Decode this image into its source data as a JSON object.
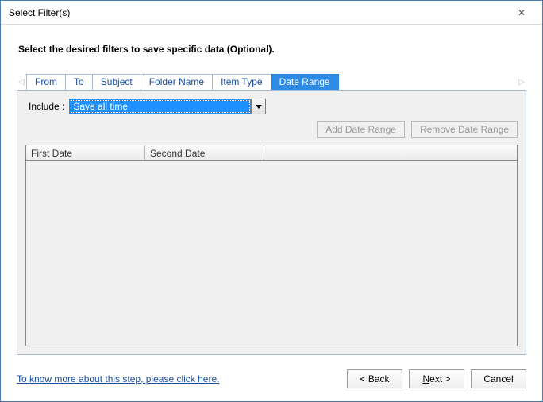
{
  "title": "Select Filter(s)",
  "instruction": "Select the desired filters to save specific data (Optional).",
  "tabs": {
    "items": [
      "From",
      "To",
      "Subject",
      "Folder Name",
      "Item Type",
      "Date Range"
    ],
    "active_index": 5
  },
  "include": {
    "label": "Include :",
    "selected": "Save all time"
  },
  "buttons": {
    "add_range": "Add Date Range",
    "remove_range": "Remove Date Range"
  },
  "grid": {
    "columns": [
      "First Date",
      "Second Date",
      ""
    ],
    "rows": []
  },
  "footer": {
    "help": "To know more about this step, please click here.",
    "back": "< Back",
    "next_prefix": "N",
    "next_suffix": "ext >",
    "cancel": "Cancel"
  }
}
